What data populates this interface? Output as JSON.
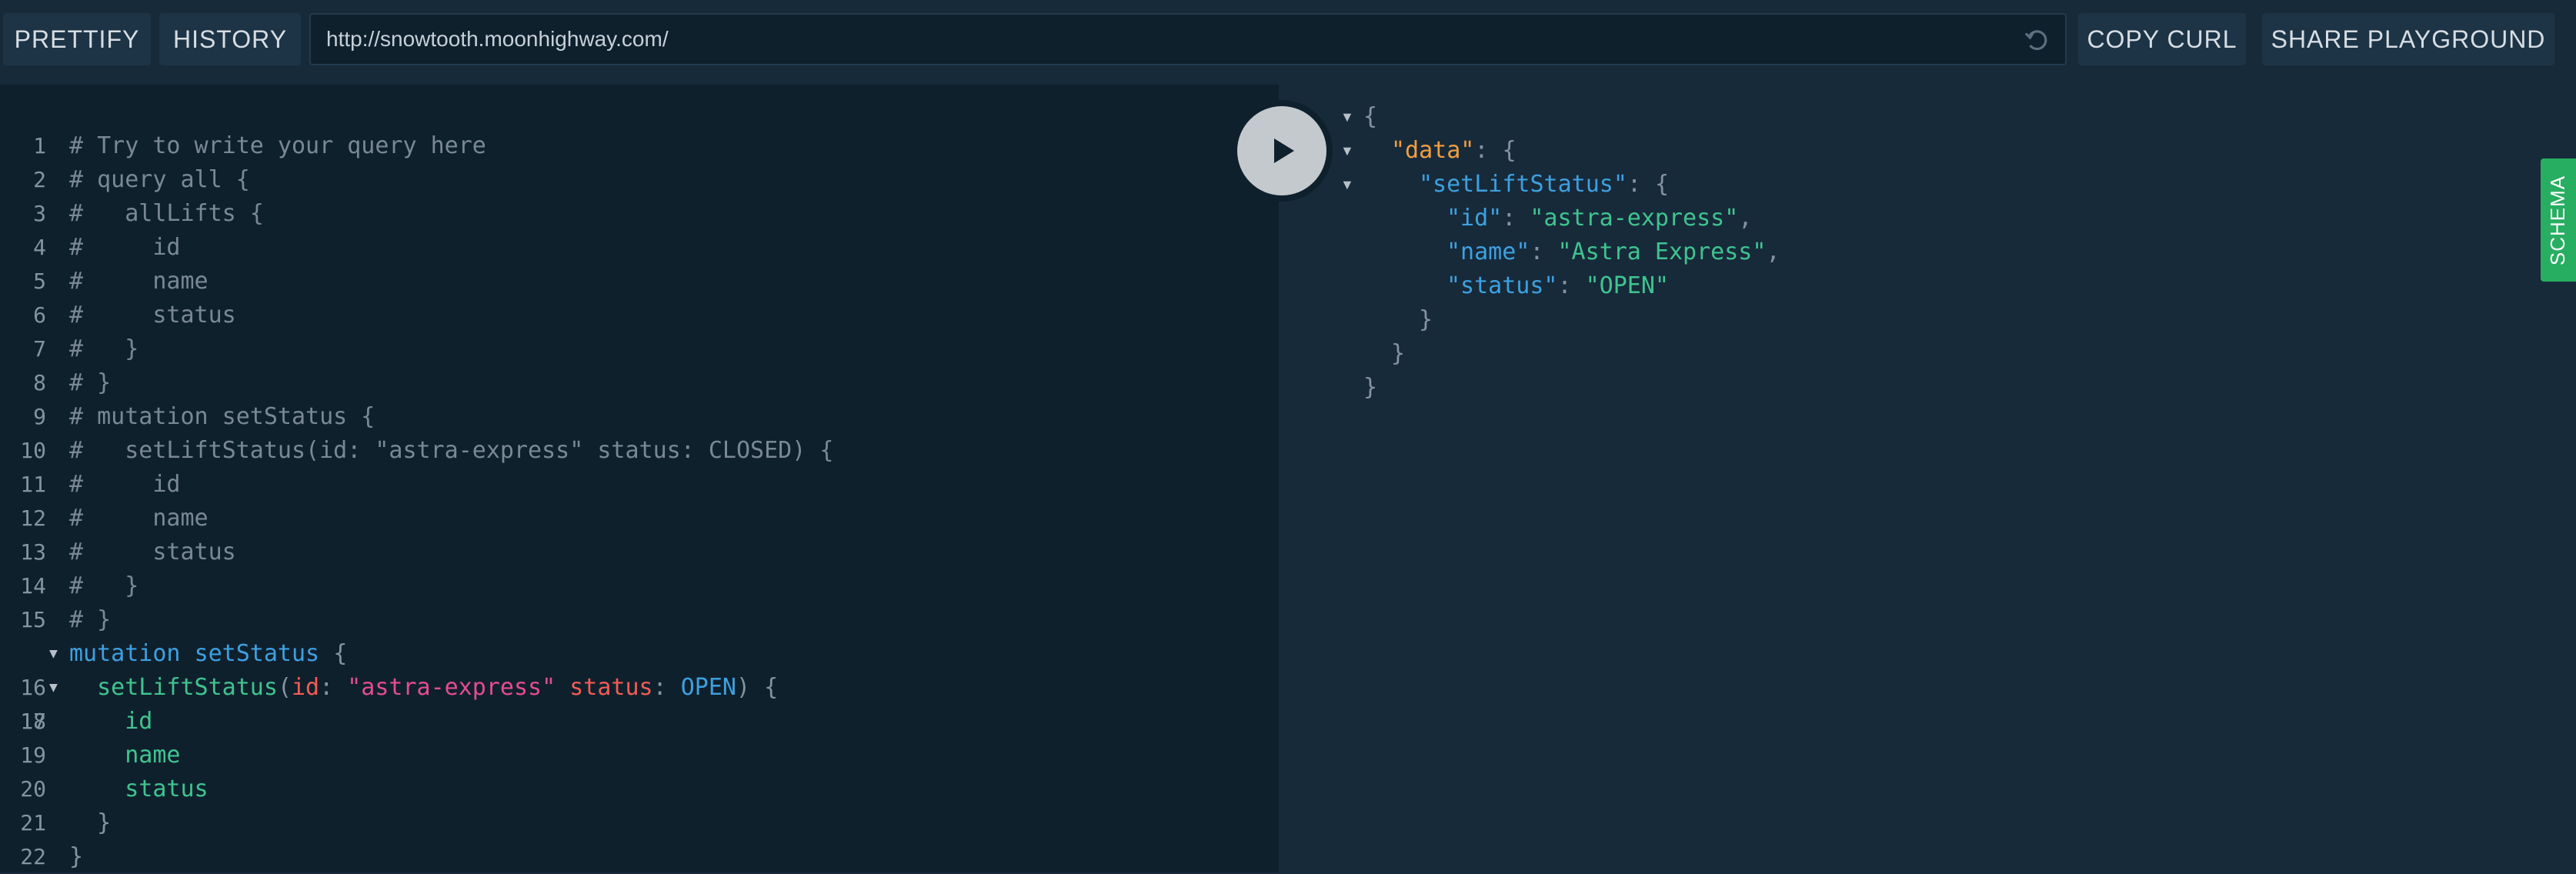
{
  "toolbar": {
    "prettify_label": "PRETTIFY",
    "history_label": "HISTORY",
    "endpoint_url": "http://snowtooth.moonhighway.com/",
    "copy_curl_label": "COPY CURL",
    "share_label": "SHARE PLAYGROUND"
  },
  "editor": {
    "line_numbers": [
      "1",
      "2",
      "3",
      "4",
      "5",
      "6",
      "7",
      "8",
      "9",
      "10",
      "11",
      "12",
      "13",
      "14",
      "15",
      "16",
      "17",
      "18",
      "19",
      "20",
      "21",
      "22"
    ],
    "comments": [
      "# Try to write your query here",
      "# query all {",
      "#   allLifts {",
      "#     id",
      "#     name",
      "#     status",
      "#   }",
      "# }",
      "# mutation setStatus {",
      "#   setLiftStatus(id: \"astra-express\" status: CLOSED) {",
      "#     id",
      "#     name",
      "#     status",
      "#   }",
      "# }"
    ],
    "mutation_keyword": "mutation",
    "operation_name": "setStatus",
    "field_name": "setLiftStatus",
    "arg_id_name": "id",
    "arg_id_value": "\"astra-express\"",
    "arg_status_name": "status",
    "arg_status_value": "OPEN",
    "selection_fields": [
      "id",
      "name",
      "status"
    ]
  },
  "result": {
    "data_key": "\"data\"",
    "field_key": "\"setLiftStatus\"",
    "entries": [
      {
        "key": "\"id\"",
        "value": "\"astra-express\"",
        "comma": ","
      },
      {
        "key": "\"name\"",
        "value": "\"Astra Express\"",
        "comma": ","
      },
      {
        "key": "\"status\"",
        "value": "\"OPEN\"",
        "comma": ""
      }
    ]
  },
  "schema_tab_label": "SCHEMA",
  "icons": {
    "run": "play-icon",
    "reload": "reload-icon",
    "fold": "triangle-down-icon"
  },
  "colors": {
    "background": "#172a3a",
    "editor_background": "#0f202d",
    "keyword": "#3ea0e0",
    "field": "#3fc48f",
    "argument": "#f25c54",
    "string": "#e44d8e",
    "data_key": "#f29e3f",
    "schema_tab": "#27ae60"
  }
}
